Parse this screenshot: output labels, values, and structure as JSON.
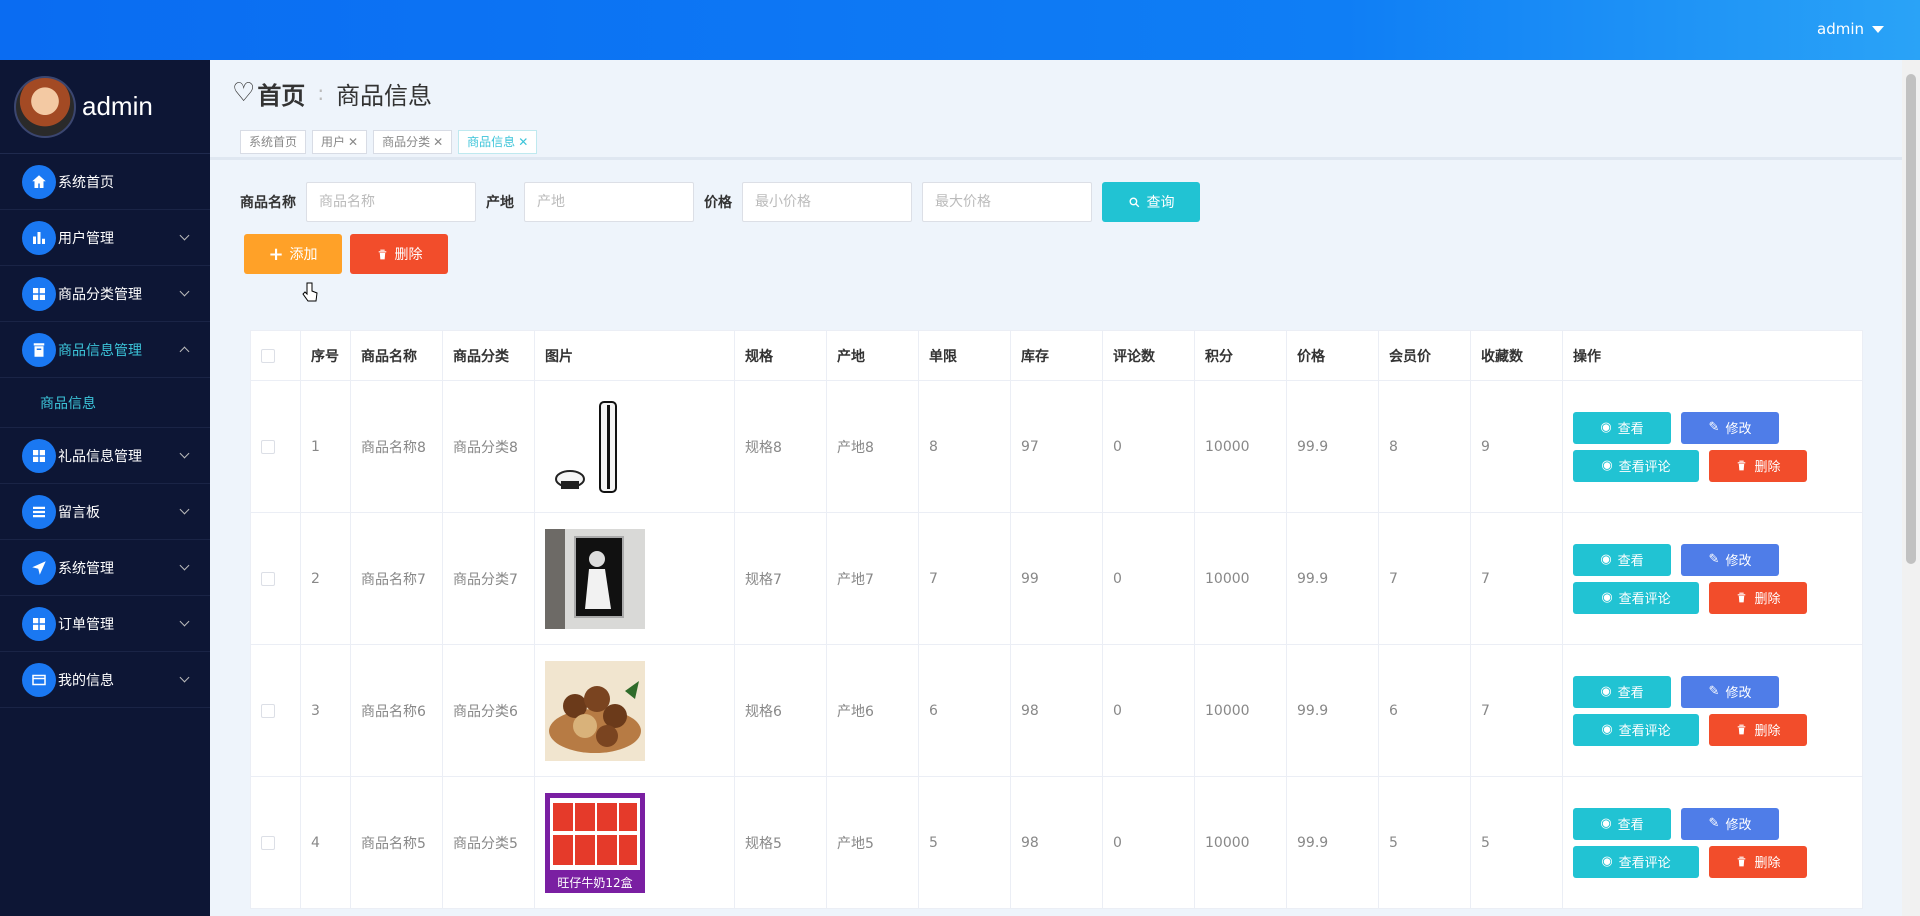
{
  "header": {
    "user": "admin"
  },
  "sidebar": {
    "profile_name": "admin",
    "items": [
      {
        "label": "系统首页",
        "icon": "home-icon"
      },
      {
        "label": "用户管理",
        "icon": "bar-chart-icon"
      },
      {
        "label": "商品分类管理",
        "icon": "grid-icon"
      },
      {
        "label": "商品信息管理",
        "icon": "box-icon"
      },
      {
        "label": "礼品信息管理",
        "icon": "grid-icon"
      },
      {
        "label": "留言板",
        "icon": "list-icon"
      },
      {
        "label": "系统管理",
        "icon": "send-icon"
      },
      {
        "label": "订单管理",
        "icon": "grid-icon"
      },
      {
        "label": "我的信息",
        "icon": "card-icon"
      }
    ],
    "submenu": {
      "label": "商品信息"
    }
  },
  "page": {
    "home": "首页",
    "current": "商品信息"
  },
  "tags": [
    {
      "label": "系统首页"
    },
    {
      "label": "用户"
    },
    {
      "label": "商品分类"
    },
    {
      "label": "商品信息"
    }
  ],
  "search": {
    "name_label": "商品名称",
    "name_placeholder": "商品名称",
    "origin_label": "产地",
    "origin_placeholder": "产地",
    "price_label": "价格",
    "min_placeholder": "最小价格",
    "max_placeholder": "最大价格",
    "query": "查询"
  },
  "toolbar": {
    "add": "添加",
    "delete": "删除"
  },
  "table": {
    "columns": [
      "序号",
      "商品名称",
      "商品分类",
      "图片",
      "规格",
      "产地",
      "单限",
      "库存",
      "评论数",
      "积分",
      "价格",
      "会员价",
      "收藏数",
      "操作"
    ],
    "rows": [
      {
        "no": "1",
        "name": "商品名称8",
        "category": "商品分类8",
        "image": "game-console",
        "spec": "规格8",
        "origin": "产地8",
        "limit": "8",
        "stock": "97",
        "comments": "0",
        "points": "10000",
        "price": "99.9",
        "member": "8",
        "favs": "9"
      },
      {
        "no": "2",
        "name": "商品名称7",
        "category": "商品分类7",
        "image": "wall-painting",
        "spec": "规格7",
        "origin": "产地7",
        "limit": "7",
        "stock": "99",
        "comments": "0",
        "points": "10000",
        "price": "99.9",
        "member": "7",
        "favs": "7"
      },
      {
        "no": "3",
        "name": "商品名称6",
        "category": "商品分类6",
        "image": "nuts",
        "spec": "规格6",
        "origin": "产地6",
        "limit": "6",
        "stock": "98",
        "comments": "0",
        "points": "10000",
        "price": "99.9",
        "member": "6",
        "favs": "7"
      },
      {
        "no": "4",
        "name": "商品名称5",
        "category": "商品分类5",
        "image": "milk-boxes",
        "spec": "规格5",
        "origin": "产地5",
        "limit": "5",
        "stock": "98",
        "comments": "0",
        "points": "10000",
        "price": "99.9",
        "member": "5",
        "favs": "5"
      }
    ],
    "ops": {
      "view": "查看",
      "edit": "修改",
      "comment": "查看评论",
      "delete": "删除"
    },
    "milk_label": "旺仔牛奶12盒"
  },
  "colors": {
    "topbar": "#0a6cf2",
    "sidebar": "#0d1635",
    "accent": "#21c3d3",
    "orange": "#ffa128",
    "red": "#f24d2b",
    "blue": "#4f7de8"
  }
}
